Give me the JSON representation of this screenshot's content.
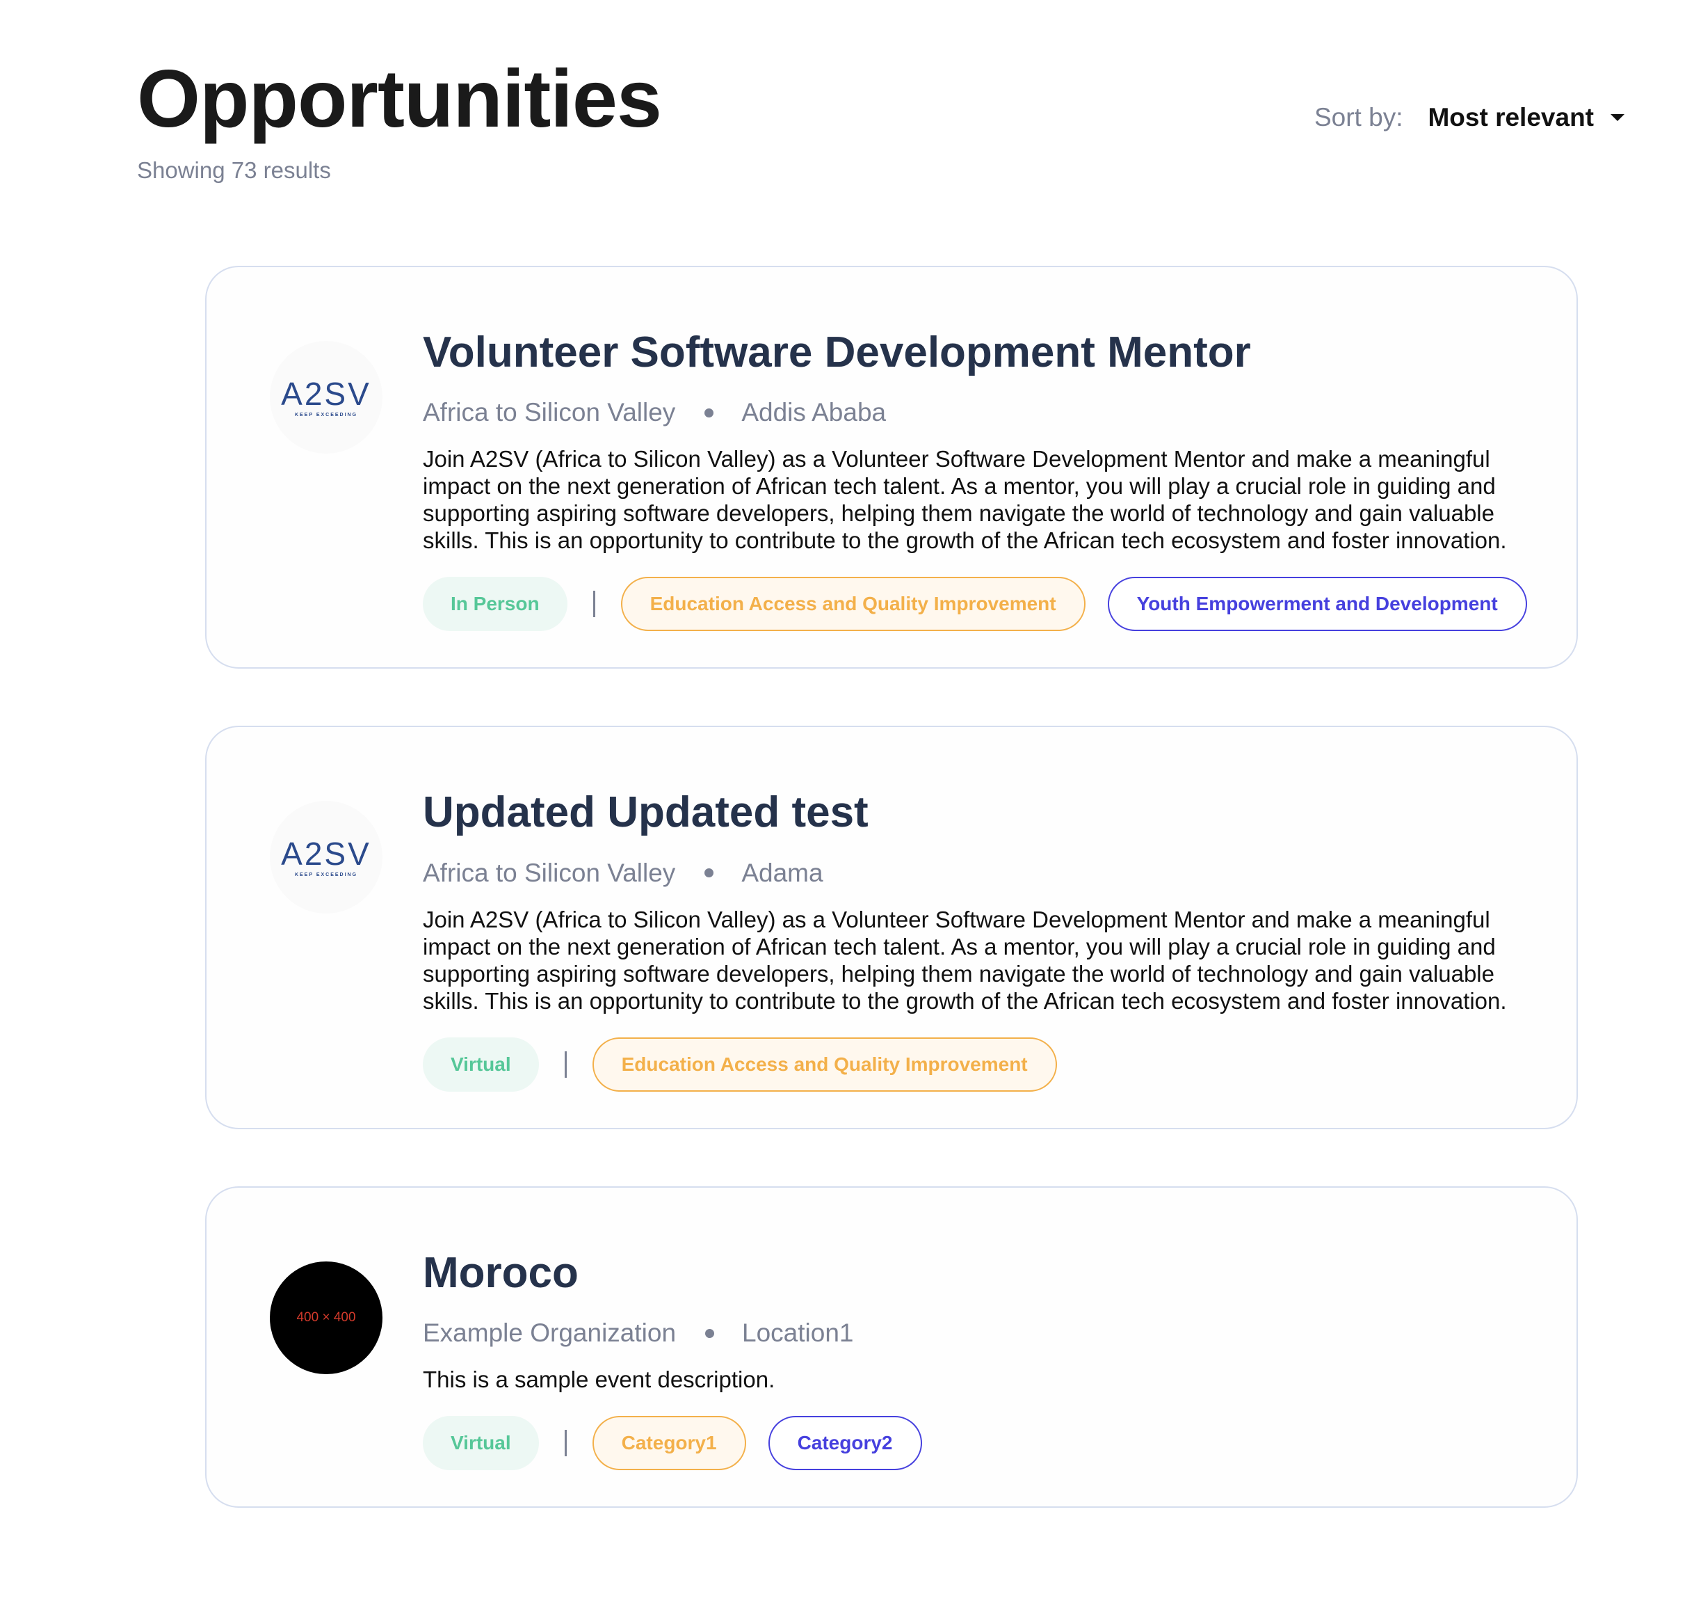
{
  "header": {
    "title": "Opportunities",
    "results": "Showing 73 results",
    "sort_label": "Sort by:",
    "sort_value": "Most relevant"
  },
  "cards": [
    {
      "logo": "A2SV",
      "logo_sub": "KEEP EXCEEDING",
      "title": "Volunteer Software Development Mentor",
      "org": "Africa to Silicon Valley",
      "location": "Addis Ababa",
      "description": "Join A2SV (Africa to Silicon Valley) as a Volunteer Software Development Mentor and make a meaningful impact on the next generation of African tech talent. As a mentor, you will play a crucial role in guiding and supporting aspiring software developers, helping them navigate the world of technology and gain valuable skills. This is an opportunity to contribute to the growth of the African tech ecosystem and foster innovation.",
      "mode": "In Person",
      "categories": [
        "Education Access and Quality Improvement",
        "Youth Empowerment and Development"
      ]
    },
    {
      "logo": "A2SV",
      "logo_sub": "KEEP EXCEEDING",
      "title": "Updated Updated test",
      "org": "Africa to Silicon Valley",
      "location": "Adama",
      "description": "Join A2SV (Africa to Silicon Valley) as a Volunteer Software Development Mentor and make a meaningful impact on the next generation of African tech talent. As a mentor, you will play a crucial role in guiding and supporting aspiring software developers, helping them navigate the world of technology and gain valuable skills. This is an opportunity to contribute to the growth of the African tech ecosystem and foster innovation.",
      "mode": "Virtual",
      "categories": [
        "Education Access and Quality Improvement"
      ]
    },
    {
      "logo_placeholder": "400 × 400",
      "title": "Moroco",
      "org": "Example Organization",
      "location": "Location1",
      "description": "This is a sample event description.",
      "mode": "Virtual",
      "categories": [
        "Category1",
        "Category2"
      ]
    }
  ],
  "colors": {
    "title": "#25324b",
    "muted": "#7b8193",
    "mode_bg": "#edf8f4",
    "mode_text": "#56c798",
    "cat1": "#f3b04a",
    "cat2": "#4640de",
    "card_border": "#d6deef"
  }
}
